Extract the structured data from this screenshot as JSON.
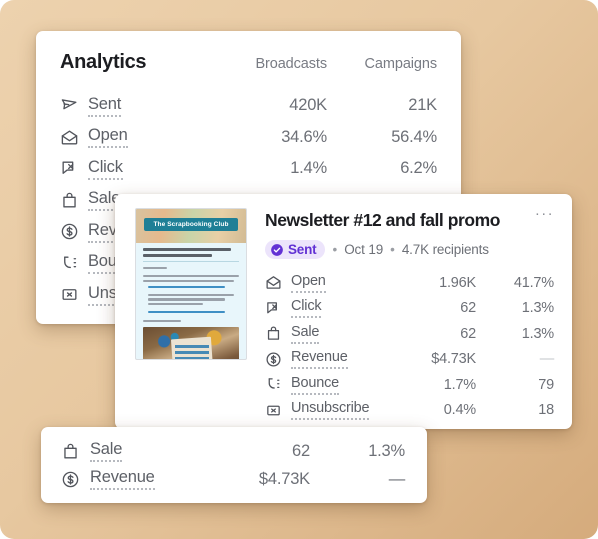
{
  "analytics": {
    "title": "Analytics",
    "columns": [
      "Broadcasts",
      "Campaigns"
    ],
    "rows": [
      {
        "icon": "paper-plane-icon",
        "label": "Sent",
        "broadcasts": "420K",
        "campaigns": "21K"
      },
      {
        "icon": "open-envelope-icon",
        "label": "Open",
        "broadcasts": "34.6%",
        "campaigns": "56.4%"
      },
      {
        "icon": "cursor-click-icon",
        "label": "Click",
        "broadcasts": "1.4%",
        "campaigns": "6.2%"
      },
      {
        "icon": "shopping-bag-icon",
        "label": "Sale",
        "broadcasts": "",
        "campaigns": ""
      },
      {
        "icon": "dollar-circle-icon",
        "label": "Revenue",
        "broadcasts": "",
        "campaigns": ""
      },
      {
        "icon": "bounce-icon",
        "label": "Bounce",
        "broadcasts": "",
        "campaigns": ""
      },
      {
        "icon": "x-box-icon",
        "label": "Unsubscribe",
        "broadcasts": "",
        "campaigns": ""
      }
    ]
  },
  "newsletter": {
    "title": "Newsletter #12 and fall promo",
    "menu_label": "···",
    "status_badge": "Sent",
    "date": "Oct 19",
    "recipients": "4.7K recipients",
    "separator": "•",
    "thumbnail": {
      "banner_title": "The Scrapbooking Club",
      "alt": "newsletter-thumbnail"
    },
    "rows": [
      {
        "icon": "open-envelope-icon",
        "label": "Open",
        "value": "1.96K",
        "rate": "41.7%"
      },
      {
        "icon": "cursor-click-icon",
        "label": "Click",
        "value": "62",
        "rate": "1.3%"
      },
      {
        "icon": "shopping-bag-icon",
        "label": "Sale",
        "value": "62",
        "rate": "1.3%"
      },
      {
        "icon": "dollar-circle-icon",
        "label": "Revenue",
        "value": "$4.73K",
        "rate": "—"
      },
      {
        "icon": "bounce-icon",
        "label": "Bounce",
        "value": "1.7%",
        "rate": "79"
      },
      {
        "icon": "x-box-icon",
        "label": "Unsubscribe",
        "value": "0.4%",
        "rate": "18"
      }
    ]
  },
  "sale_overlay": {
    "rows": [
      {
        "icon": "shopping-bag-icon",
        "label": "Sale",
        "value": "62",
        "rate": "1.3%"
      },
      {
        "icon": "dollar-circle-icon",
        "label": "Revenue",
        "value": "$4.73K",
        "rate": "—"
      }
    ]
  },
  "colors": {
    "background_light": "#edd2ae",
    "background_dark": "#d5ab7c",
    "card": "#ffffff",
    "text_primary": "#1c1d21",
    "text_secondary": "#6d7077",
    "badge_bg": "#ece4fb",
    "badge_fg": "#6231d4",
    "banner_teal": "#1f7f96"
  }
}
